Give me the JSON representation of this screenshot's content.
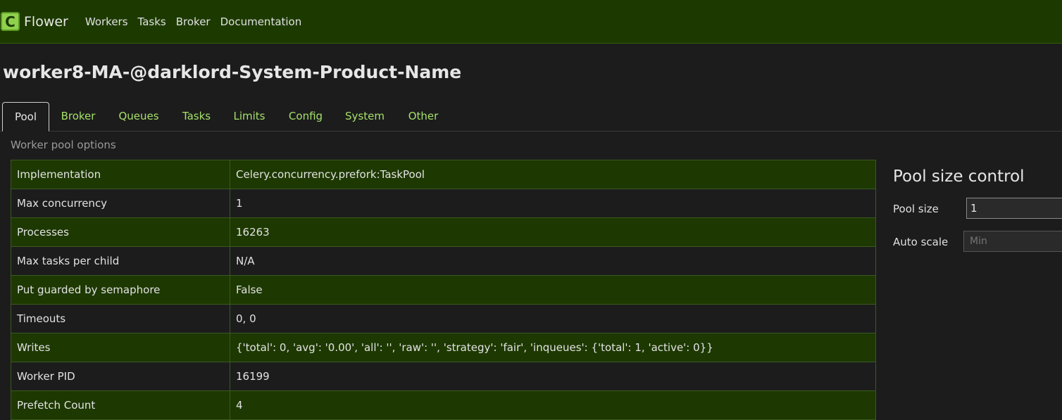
{
  "navbar": {
    "brand_letter": "C",
    "brand": "Flower",
    "items": [
      "Workers",
      "Tasks",
      "Broker",
      "Documentation"
    ]
  },
  "worker": {
    "name": "worker8-MA-@darklord-System-Product-Name"
  },
  "tabs": [
    "Pool",
    "Broker",
    "Queues",
    "Tasks",
    "Limits",
    "Config",
    "System",
    "Other"
  ],
  "active_tab": "Pool",
  "section_label": "Worker pool options",
  "options": [
    {
      "key": "Implementation",
      "value": "Celery.concurrency.prefork:TaskPool"
    },
    {
      "key": "Max concurrency",
      "value": "1"
    },
    {
      "key": "Processes",
      "value": "16263"
    },
    {
      "key": "Max tasks per child",
      "value": "N/A"
    },
    {
      "key": "Put guarded by semaphore",
      "value": "False"
    },
    {
      "key": "Timeouts",
      "value": "0, 0"
    },
    {
      "key": "Writes",
      "value": "{'total': 0, 'avg': '0.00', 'all': '', 'raw': '', 'strategy': 'fair', 'inqueues': {'total': 1, 'active': 0}}"
    },
    {
      "key": "Worker PID",
      "value": "16199"
    },
    {
      "key": "Prefetch Count",
      "value": "4"
    }
  ],
  "pool_control": {
    "title": "Pool size control",
    "pool_size_label": "Pool size",
    "pool_size_value": "1",
    "autoscale_label": "Auto scale",
    "autoscale_min_placeholder": "Min"
  }
}
